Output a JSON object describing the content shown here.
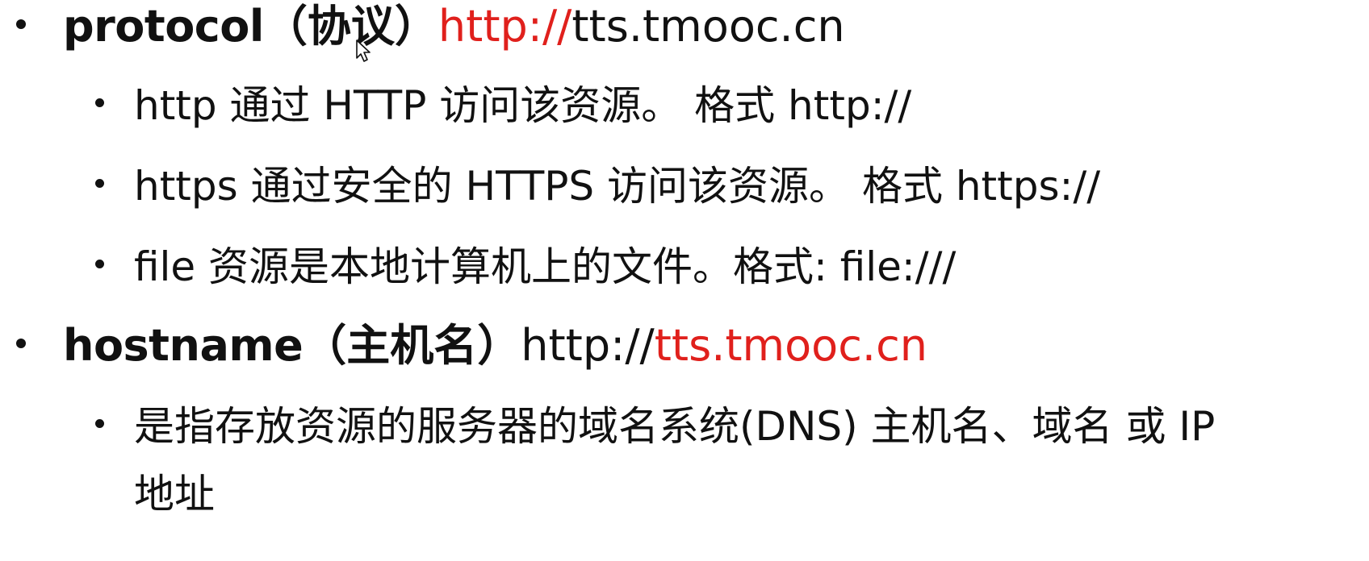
{
  "items": [
    {
      "keyword": "protocol",
      "paren_label": "（协议）",
      "url_highlight": "http://",
      "url_rest": "tts.tmooc.cn",
      "children": [
        {
          "text": "http 通过 HTTP 访问该资源。 格式  http://"
        },
        {
          "text": "https 通过安全的 HTTPS 访问该资源。 格式 https://"
        },
        {
          "text": "file 资源是本地计算机上的文件。格式:  file:///"
        }
      ]
    },
    {
      "keyword": "hostname",
      "paren_label": "（主机名）",
      "url_prefix": "http://",
      "url_highlight": "tts.tmooc.cn",
      "children": [
        {
          "text_line1": "是指存放资源的服务器的域名系统(DNS) 主机名、域名 或 IP",
          "text_line2": "地址"
        }
      ]
    }
  ],
  "colors": {
    "highlight": "#e0201c",
    "text": "#111111",
    "background": "#ffffff"
  },
  "icons": [
    "mouse-pointer-icon"
  ]
}
